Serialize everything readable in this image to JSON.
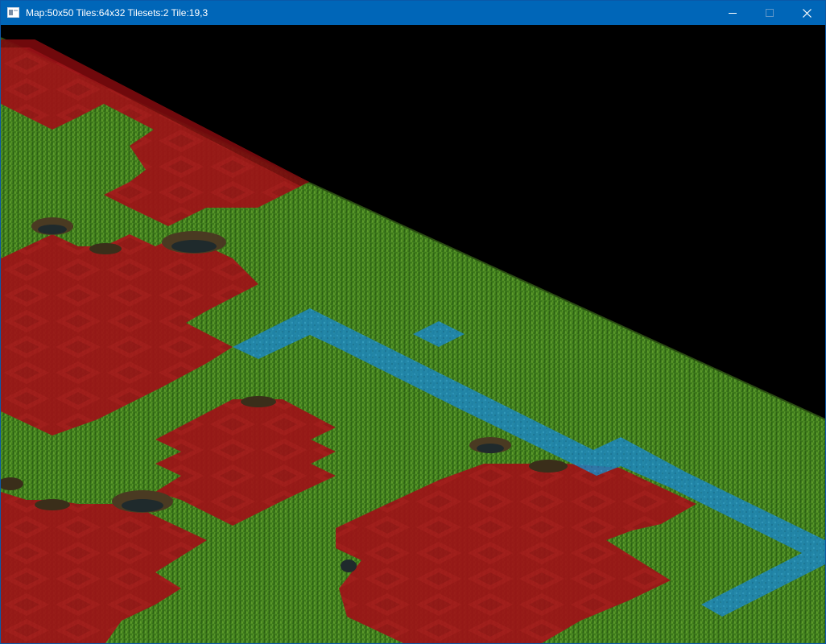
{
  "window": {
    "title": "Map:50x50 Tiles:64x32 Tilesets:2 Tile:19,3"
  },
  "controls": {
    "minimize_icon": "minimize-icon",
    "maximize_icon": "maximize-icon",
    "close_icon": "close-icon"
  },
  "map": {
    "background_color": "#000000",
    "grass_color": "#3f7a1c",
    "red_overlay_color": "#a3141a",
    "water_color": "#1e8cc8"
  }
}
